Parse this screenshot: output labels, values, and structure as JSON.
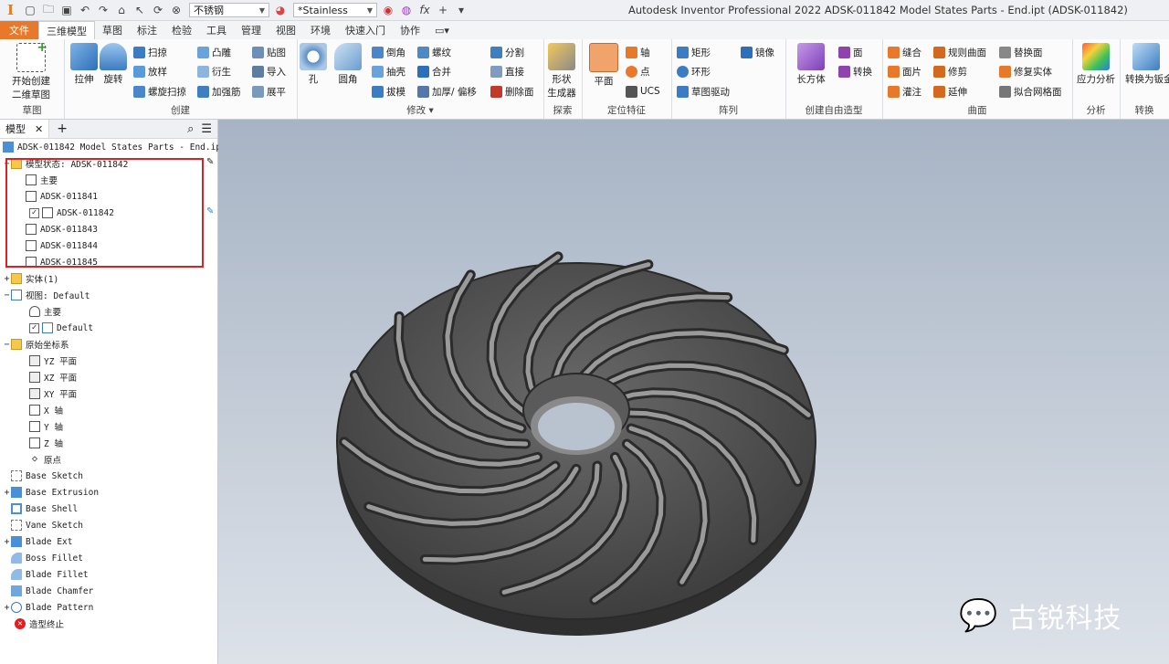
{
  "titlebar": {
    "material": "不锈钢",
    "appearance": "*Stainless",
    "app_title": "Autodesk Inventor Professional 2022    ADSK-011842 Model States Parts - End.ipt (ADSK-011842)"
  },
  "menu": {
    "tabs": [
      "文件",
      "三维模型",
      "草图",
      "标注",
      "检验",
      "工具",
      "管理",
      "视图",
      "环境",
      "快速入门",
      "协作"
    ]
  },
  "ribbon": {
    "sketch": {
      "start": "开始创建",
      "sketch2d": "二维草图",
      "label": "草图"
    },
    "create": {
      "extrude": "拉伸",
      "revolve": "旋转",
      "sweep": "扫掠",
      "loft": "放样",
      "coil": "螺旋扫掠",
      "emboss": "凸雕",
      "derive": "衍生",
      "rib": "加强筋",
      "decal": "贴图",
      "import": "导入",
      "unwrap": "展平",
      "label": "创建"
    },
    "modify": {
      "hole": "孔",
      "fillet": "圆角",
      "chamfer": "倒角",
      "shell": "抽壳",
      "draft": "拔模",
      "thread": "螺纹",
      "combine": "合并",
      "thicken": "加厚/ 偏移",
      "split": "分割",
      "direct": "直接",
      "delete_face": "删除面",
      "label": "修改"
    },
    "explore": {
      "shape_gen_1": "形状",
      "shape_gen_2": "生成器",
      "label": "探索"
    },
    "work": {
      "plane": "平面",
      "axis": "轴",
      "point": "点",
      "ucs": "UCS",
      "label": "定位特征"
    },
    "pattern": {
      "rect": "矩形",
      "circ": "环形",
      "sketch_driven": "草图驱动",
      "mirror": "镜像",
      "label": "阵列"
    },
    "freeform": {
      "box": "长方体",
      "face": "面",
      "convert": "转换",
      "label": "创建自由造型"
    },
    "surface": {
      "stitch": "缝合",
      "ruled": "规则曲面",
      "replace": "替换面",
      "patch": "面片",
      "trim": "修剪",
      "repair": "修复实体",
      "sculpt": "灌注",
      "extend": "延伸",
      "mesh": "拟合网格面",
      "label": "曲面"
    },
    "analysis": {
      "stress": "应力分析",
      "label": "分析"
    },
    "convert": {
      "to_sheet": "转换为钣金",
      "label": "转换"
    }
  },
  "browser": {
    "tab": "模型",
    "root": "ADSK-011842 Model States Parts - End.ipt",
    "model_states": "模型状态: ADSK-011842",
    "states": [
      "主要",
      "ADSK-011841",
      "ADSK-011842",
      "ADSK-011843",
      "ADSK-011844",
      "ADSK-011845"
    ],
    "solid": "实体(1)",
    "view": "视图: Default",
    "views": [
      "主要",
      "Default"
    ],
    "origin": "原始坐标系",
    "origin_items": [
      "YZ 平面",
      "XZ 平面",
      "XY 平面",
      "X 轴",
      "Y 轴",
      "Z 轴",
      "原点"
    ],
    "features": [
      "Base Sketch",
      "Base Extrusion",
      "Base Shell",
      "Vane Sketch",
      "Blade Ext",
      "Boss Fillet",
      "Blade Fillet",
      "Blade Chamfer",
      "Blade Pattern"
    ],
    "end": "造型终止"
  },
  "watermark": "古锐科技",
  "colors": {
    "accent": "#e8792b",
    "highlight": "#e02020"
  }
}
